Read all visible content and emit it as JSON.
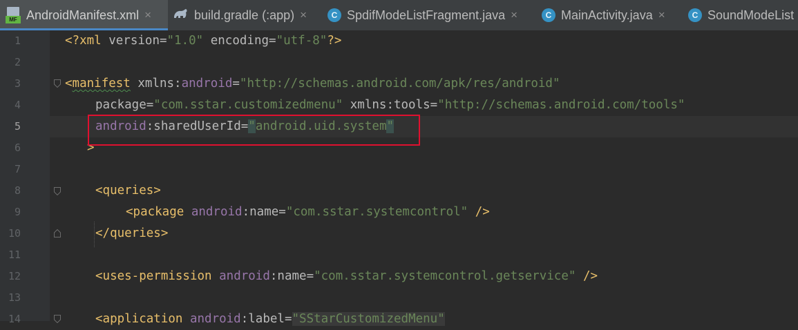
{
  "tabs": [
    {
      "label": "AndroidManifest.xml",
      "icon": "manifest-icon",
      "active": true
    },
    {
      "label": "build.gradle (:app)",
      "icon": "gradle-icon",
      "active": false
    },
    {
      "label": "SpdifModeListFragment.java",
      "icon": "class-icon",
      "active": false
    },
    {
      "label": "MainActivity.java",
      "icon": "class-icon",
      "active": false
    },
    {
      "label": "SoundModeList",
      "icon": "class-icon",
      "active": false
    }
  ],
  "gutter": {
    "line_numbers": [
      "1",
      "2",
      "3",
      "4",
      "5",
      "6",
      "7",
      "8",
      "9",
      "10",
      "11",
      "12",
      "13",
      "14"
    ],
    "current_line": "5"
  },
  "code": {
    "l1": {
      "lt": "<?",
      "tag": "xml",
      "a1": " version=",
      "v1": "\"1.0\"",
      "a2": " encoding=",
      "v2": "\"utf-8\"",
      "end": "?>"
    },
    "l3": {
      "lt": "<",
      "tag": "manifest",
      "a1": " xmlns:",
      "ns": "android",
      "eq": "=",
      "v": "\"http://schemas.android.com/apk/res/android\""
    },
    "l4": {
      "a1": "package=",
      "v1": "\"com.sstar.customizedmenu\"",
      "a2": " xmlns:tools=",
      "v2": "\"http://schemas.android.com/tools\""
    },
    "l5": {
      "ns": "android",
      "a": ":sharedUserId=",
      "q1": "\"",
      "v": "android.uid.system",
      "q2": "\""
    },
    "l6": {
      "gt": ">"
    },
    "l8": {
      "t": "<queries>"
    },
    "l9": {
      "lt": "<package ",
      "ns": "android",
      "a": ":name=",
      "v": "\"com.sstar.systemcontrol\"",
      "end": " />"
    },
    "l10": {
      "t": "</queries>"
    },
    "l12": {
      "lt": "<uses-permission ",
      "ns": "android",
      "a": ":name=",
      "v": "\"com.sstar.systemcontrol.getservice\"",
      "end": " />"
    },
    "l14": {
      "lt": "<application ",
      "ns": "android",
      "a": ":label=",
      "v": "\"SStarCustomizedMenu\""
    }
  },
  "colors": {
    "tag": "#e8bf6a",
    "namespace": "#9876aa",
    "string": "#6a8759",
    "attribute": "#bababa",
    "highlight_box": "#e0102f"
  }
}
